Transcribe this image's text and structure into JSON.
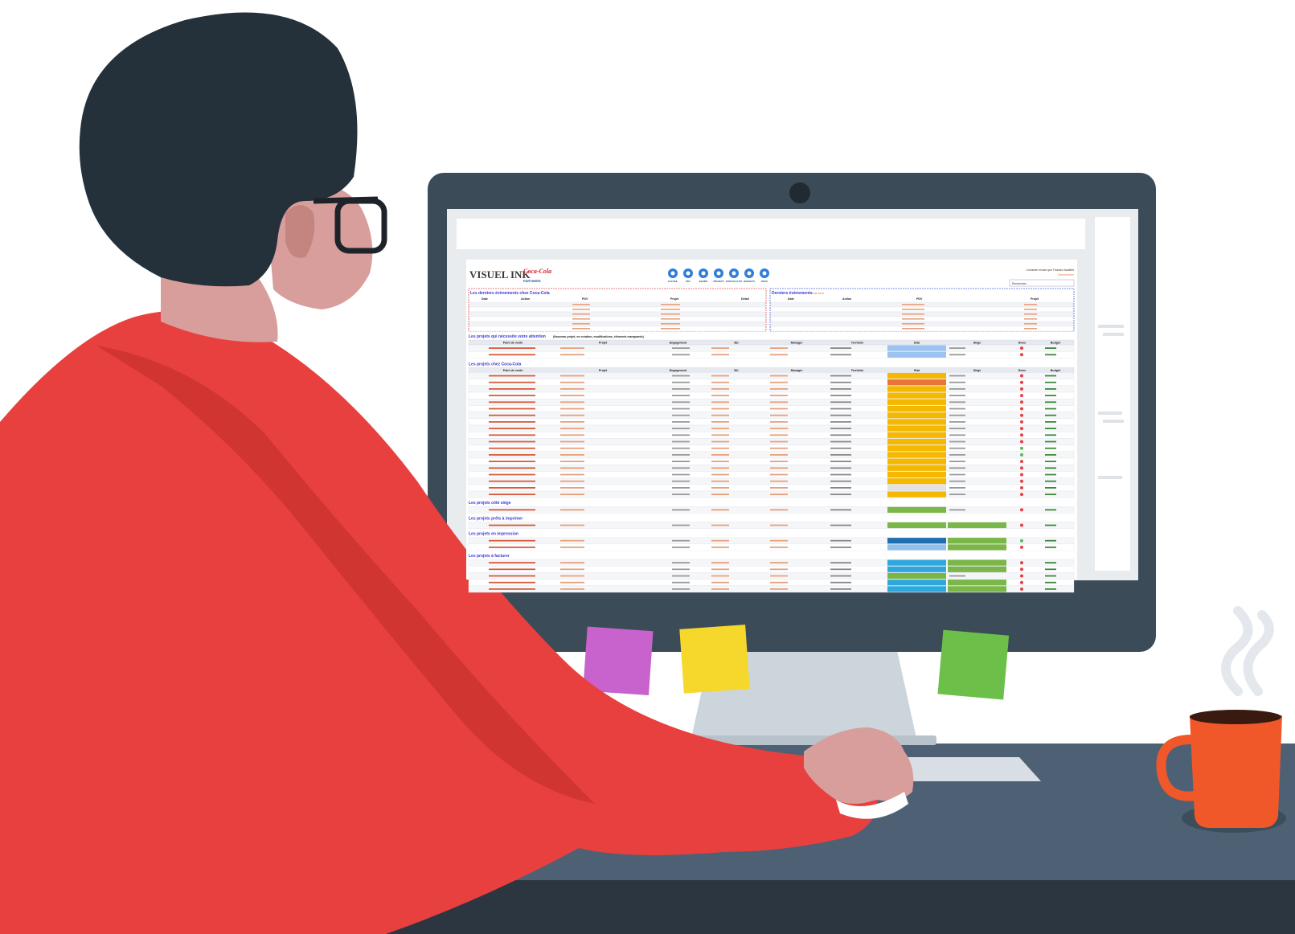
{
  "screen": {
    "brand": {
      "logo_text": "VISUEL INK",
      "partner_logo": "Coca-Cola",
      "partner_label": "PARTNERS"
    },
    "nav_icons": [
      {
        "name": "home-icon",
        "label": "ACCUEIL"
      },
      {
        "name": "pdv-icon",
        "label": "PDV"
      },
      {
        "name": "team-icon",
        "label": "EQUIPE"
      },
      {
        "name": "projects-icon",
        "label": "PROJETS"
      },
      {
        "name": "photos-icon",
        "label": "PHOTOS CUTS"
      },
      {
        "name": "budgets-icon",
        "label": "BUDGETS"
      },
      {
        "name": "docs-icon",
        "label": "DOCS"
      }
    ],
    "user": {
      "line1": "Connecté en tant que Thomas Vaudelet",
      "logout": "Déconnexion",
      "search_placeholder": "Rechercher..."
    },
    "panels": {
      "left_title": "Les derniers évènements chez Coca-Cola",
      "right_title": "Derniers évènements",
      "right_badge": "Voir tout",
      "left_headers": [
        "Date",
        "Action",
        "PDV",
        "Projet",
        "Détail"
      ],
      "right_headers": [
        "Date",
        "Action",
        "PDV",
        "Projet"
      ]
    },
    "sections": {
      "attention": "Les projets qui nécessite votre attention",
      "attention_note": "(Nouveau projet, en création, modifications, éléments manquants)",
      "coca": "Les projets chez Coca-Cola",
      "cote_siege": "Les projets côté siège",
      "prets": "Les projets prêts à imprimer",
      "impression": "Les projets en impression",
      "facturer": "Les projets à facturer"
    },
    "table_headers": [
      "Point de vente",
      "Projet",
      "Engagement",
      "BU",
      "Manager",
      "Territoire",
      "Etat",
      "Siège",
      "Bons",
      "Budget"
    ]
  }
}
